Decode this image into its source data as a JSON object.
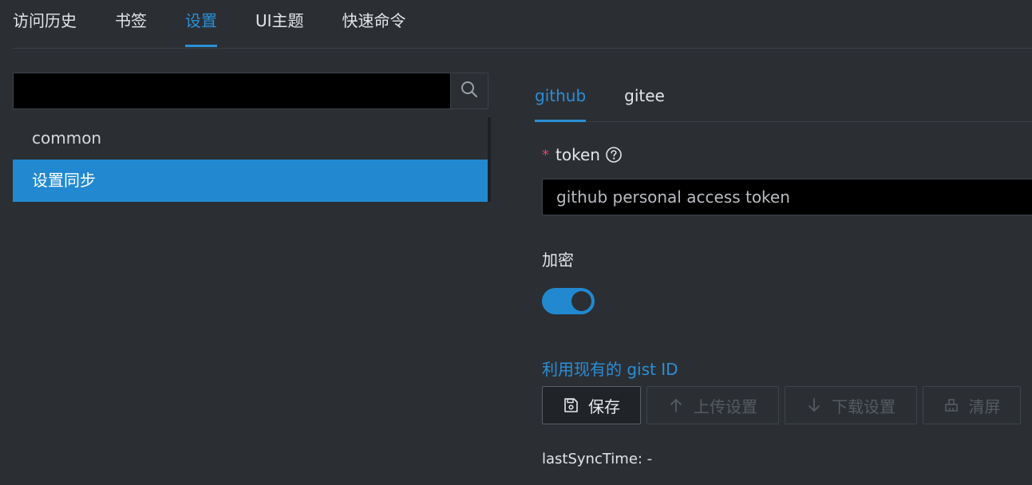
{
  "top_tabs": [
    {
      "label": "访问历史",
      "active": false
    },
    {
      "label": "书签",
      "active": false
    },
    {
      "label": "设置",
      "active": true
    },
    {
      "label": "UI主题",
      "active": false
    },
    {
      "label": "快速命令",
      "active": false
    }
  ],
  "search": {
    "value": "",
    "placeholder": "",
    "icon": "search-icon"
  },
  "nav": {
    "items": [
      {
        "label": "common",
        "active": false
      },
      {
        "label": "设置同步",
        "active": true
      }
    ]
  },
  "sync": {
    "tabs": [
      {
        "label": "github",
        "active": true
      },
      {
        "label": "gitee",
        "active": false
      }
    ],
    "token_label": "token",
    "required_mark": "*",
    "token_value": "",
    "token_placeholder": "github personal access token",
    "encrypt_label": "加密",
    "encrypt_enabled": true,
    "gist_link": "利用现有的 gist ID",
    "buttons": {
      "save": "保存",
      "upload": "上传设置",
      "download": "下载设置",
      "clear": "清屏"
    },
    "last_sync": "lastSyncTime: -"
  },
  "colors": {
    "accent": "#2289d1",
    "background": "#2b2f34",
    "required": "#e0436a"
  }
}
